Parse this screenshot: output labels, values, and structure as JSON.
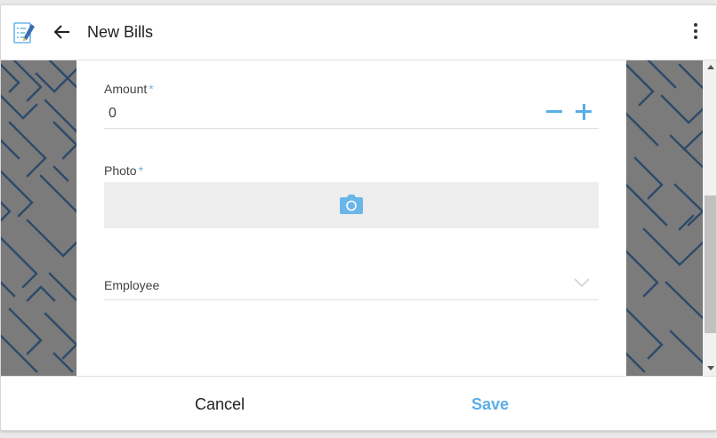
{
  "header": {
    "title": "New Bills",
    "app_icon": "notes-icon",
    "back_icon": "arrow-left-icon",
    "menu_icon": "more-vertical-icon"
  },
  "form": {
    "amount": {
      "label": "Amount",
      "required_mark": "*",
      "value": "0"
    },
    "photo": {
      "label": "Photo",
      "required_mark": "*",
      "icon": "camera-icon"
    },
    "employee": {
      "label": "Employee",
      "value": ""
    }
  },
  "footer": {
    "cancel_label": "Cancel",
    "save_label": "Save"
  },
  "colors": {
    "accent": "#5aaee8",
    "pattern_bg": "#7b7b7b",
    "pattern_line": "#2d4a6b"
  }
}
